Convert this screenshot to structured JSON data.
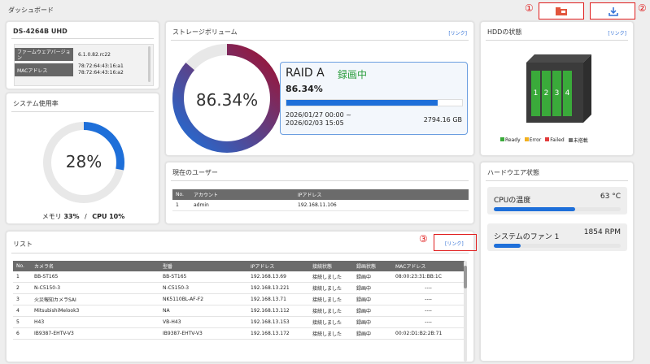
{
  "page_title": "ダッシュボード",
  "callouts": {
    "c1": "①",
    "c2": "②",
    "c3": "③"
  },
  "device": {
    "model": "DS-4264B UHD",
    "firmware_label": "ファームウェアバージョン",
    "firmware_value": "6.1.0.82.rc22",
    "mac_label": "MACアドレス",
    "mac_values": "78:72:64:43:16:a1\n78:72:64:43:16:a2"
  },
  "system_usage": {
    "title": "システム使用率",
    "percent_text": "28%",
    "percent": 28,
    "memory_label": "メモリ",
    "memory_value": "33%",
    "sep": "/",
    "cpu_label": "CPU",
    "cpu_value": "10%"
  },
  "storage": {
    "title": "ストレージボリューム",
    "link": "[リンク]",
    "percent_text": "86.34%",
    "percent": 86.34,
    "raid_name": "RAID A",
    "raid_status": "録画中",
    "raid_percent_text": "86.34%",
    "date_range": "2026/01/27 00:00 ~\n2026/02/03 15:05",
    "capacity": "2794.16 GB"
  },
  "hdd": {
    "title": "HDDの状態",
    "link": "[リンク]",
    "bays": [
      "1",
      "2",
      "3",
      "4"
    ],
    "legend": [
      {
        "label": "Ready",
        "color": "#3aaa3a"
      },
      {
        "label": "Error",
        "color": "#f2b01e"
      },
      {
        "label": "Failed",
        "color": "#e23b3b"
      },
      {
        "label": "未搭載",
        "color": "#777777"
      }
    ]
  },
  "users": {
    "title": "現在のユーザー",
    "columns": [
      "No.",
      "アカウント",
      "IPアドレス"
    ],
    "rows": [
      [
        "1",
        "admin",
        "192.168.11.106"
      ]
    ]
  },
  "hardware": {
    "title": "ハードウエア状態",
    "cpu_temp_label": "CPUの温度",
    "cpu_temp_value": "63 °C",
    "cpu_temp_fraction": 0.64,
    "fan_label": "システムのファン 1",
    "fan_value": "1854 RPM",
    "fan_fraction": 0.21
  },
  "list": {
    "title": "リスト",
    "link": "[リンク]",
    "columns": [
      "No.",
      "カメラ名",
      "型番",
      "IPアドレス",
      "接続状態",
      "録画状態",
      "MACアドレス"
    ],
    "rows": [
      [
        "1",
        "BB-ST165",
        "BB-ST165",
        "192.168.13.69",
        "接続しました",
        "録画中",
        "08:00:23:31:BB:1C"
      ],
      [
        "2",
        "N-C5150-3",
        "N-C5150-3",
        "192.168.13.221",
        "接続しました",
        "録画中",
        "----"
      ],
      [
        "3",
        "火災報知カメラSAI",
        "NK5110BL-AF-F2",
        "192.168.13.71",
        "接続しました",
        "録画中",
        "----"
      ],
      [
        "4",
        "MitsubishiMelook3",
        "NA",
        "192.168.13.112",
        "接続しました",
        "録画中",
        "----"
      ],
      [
        "5",
        "H43",
        "VB-H43",
        "192.168.13.153",
        "接続しました",
        "録画中",
        "----"
      ],
      [
        "6",
        "IB9387-EHTV-V3",
        "IB9387-EHTV-V3",
        "192.168.13.172",
        "接続しました",
        "録画中",
        "00:02:D1:B2:2B:71"
      ]
    ]
  }
}
